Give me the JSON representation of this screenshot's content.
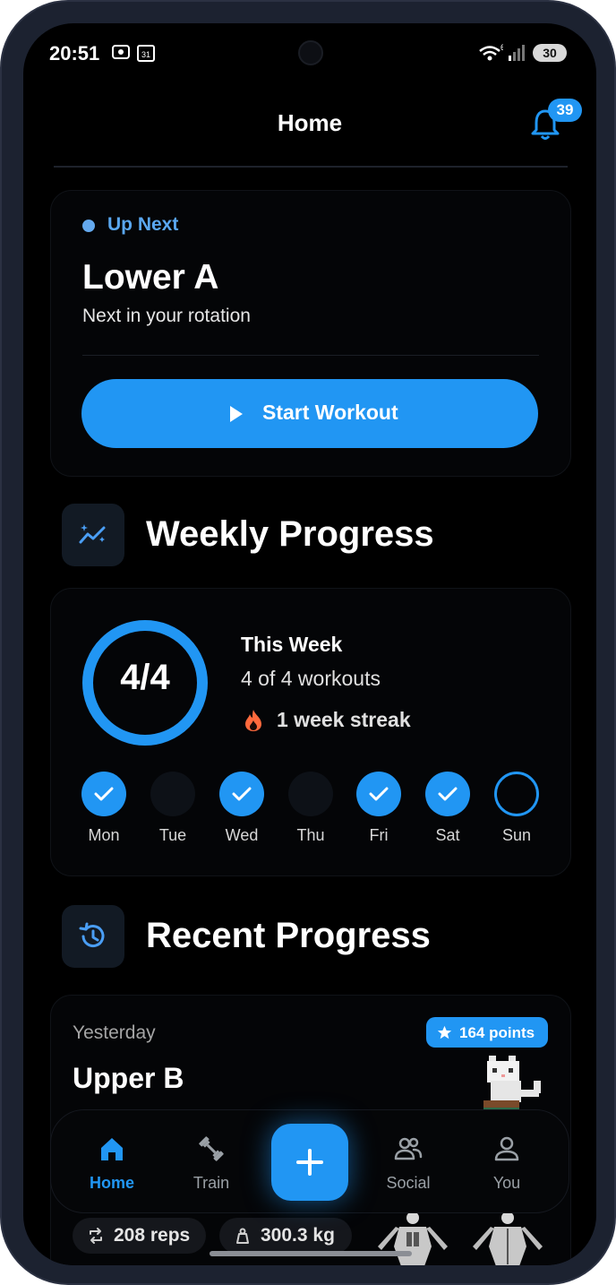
{
  "status_bar": {
    "time": "20:51",
    "calendar_day": "31",
    "wifi_badge": "6",
    "battery": "30"
  },
  "header": {
    "title": "Home",
    "notification_count": "39"
  },
  "up_next": {
    "label": "Up Next",
    "workout_name": "Lower A",
    "subtitle": "Next in your rotation",
    "start_button": "Start Workout"
  },
  "weekly_progress": {
    "section_title": "Weekly Progress",
    "completed_display": "4/4",
    "completed_fraction": 1.0,
    "title": "This Week",
    "workouts_text": "4 of 4 workouts",
    "streak_text": "1 week streak",
    "days": [
      {
        "label": "Mon",
        "state": "done"
      },
      {
        "label": "Tue",
        "state": "empty"
      },
      {
        "label": "Wed",
        "state": "done"
      },
      {
        "label": "Thu",
        "state": "empty"
      },
      {
        "label": "Fri",
        "state": "done"
      },
      {
        "label": "Sat",
        "state": "done"
      },
      {
        "label": "Sun",
        "state": "today"
      }
    ]
  },
  "recent_progress": {
    "section_title": "Recent Progress",
    "when": "Yesterday",
    "workout_name": "Upper B",
    "points": "164 points",
    "reps": "208 reps",
    "volume": "300.3 kg"
  },
  "bottom_nav": {
    "items": [
      {
        "label": "Home",
        "icon": "home-icon",
        "active": true
      },
      {
        "label": "Train",
        "icon": "dumbbell-icon",
        "active": false
      },
      {
        "label": "Social",
        "icon": "people-icon",
        "active": false
      },
      {
        "label": "You",
        "icon": "person-icon",
        "active": false
      }
    ],
    "fab_icon": "plus-icon"
  },
  "colors": {
    "accent": "#2196f3",
    "accent_light": "#5aa7f0",
    "background": "#000000",
    "streak_fire": "#ff6a3d"
  }
}
